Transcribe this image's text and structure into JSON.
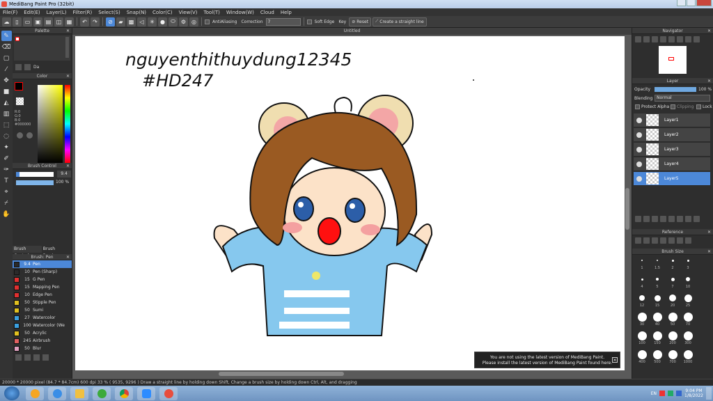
{
  "window": {
    "title": "MediBang Paint Pro (32bit)"
  },
  "menu": [
    "File(F)",
    "Edit(E)",
    "Layer(L)",
    "Filter(R)",
    "Select(S)",
    "Snap(N)",
    "Color(C)",
    "View(V)",
    "Tool(T)",
    "Window(W)",
    "Cloud",
    "Help"
  ],
  "toolbar": {
    "antialias_label": "AntiAliasing",
    "correction_label": "Correction",
    "correction_value": "7",
    "soft_edge_label": "Soft Edge",
    "key_label": "Key",
    "reset_label": "Reset",
    "straight_label": "Create a straight line"
  },
  "canvas": {
    "tab_title": "Untitled",
    "handwriting_line1": "nguyenthithuydung12345",
    "handwriting_line2": "#HD247"
  },
  "left_panels": {
    "palette": "Palette",
    "palette_item": "Da",
    "color": "Color",
    "rgb": [
      "R:0",
      "G:0",
      "B:0"
    ],
    "hex": "#000000",
    "brush_control": "Brush Control",
    "brush_size_value": "9.4",
    "brush_opacity_value": "100 %",
    "tab_brush_control": "Brush Control",
    "tab_brush_preview": "Brush Preview",
    "brush_list_title": "Brush: Pen"
  },
  "brushes": [
    {
      "size": "9.4",
      "name": "Pen",
      "color": "#2a2a2a"
    },
    {
      "size": "10",
      "name": "Pen (Sharp)",
      "color": "#2a2a2a"
    },
    {
      "size": "15",
      "name": "G Pen",
      "color": "#e03030"
    },
    {
      "size": "15",
      "name": "Mapping Pen",
      "color": "#e03030"
    },
    {
      "size": "10",
      "name": "Edge Pen",
      "color": "#e03030"
    },
    {
      "size": "50",
      "name": "Stipple Pen",
      "color": "#e0c020"
    },
    {
      "size": "50",
      "name": "Sumi",
      "color": "#e0c020"
    },
    {
      "size": "27",
      "name": "Watercolor",
      "color": "#3aa0e0"
    },
    {
      "size": "100",
      "name": "Watercolor (We",
      "color": "#3aa0e0"
    },
    {
      "size": "50",
      "name": "Acrylic",
      "color": "#e0c020"
    },
    {
      "size": "245",
      "name": "Airbrush",
      "color": "#e06060"
    },
    {
      "size": "50",
      "name": "Blur",
      "color": "#e0a0c0"
    }
  ],
  "right_panels": {
    "navigator": "Navigator",
    "layer": "Layer",
    "opacity_label": "Opacity",
    "opacity_value": "100 %",
    "blending_label": "Blending",
    "blending_value": "Normal",
    "protect_alpha": "Protect Alpha",
    "clipping": "Clipping",
    "lock": "Lock",
    "reference": "Reference",
    "brush_size": "Brush Size"
  },
  "layers": [
    "Layer1",
    "Layer2",
    "Layer3",
    "Layer4",
    "Layer5"
  ],
  "brush_sizes": [
    "1",
    "1.5",
    "2",
    "3",
    "4",
    "5",
    "7",
    "10",
    "12",
    "15",
    "20",
    "25",
    "30",
    "40",
    "50",
    "70",
    "100",
    "150",
    "200",
    "300",
    "400",
    "500",
    "700",
    "1000"
  ],
  "notice": {
    "line1": "You are not using the latest version of MediBang Paint.",
    "line2": "Please install the latest version of MediBang Paint found here."
  },
  "status": {
    "text": "20000 * 20000 pixel  (84.7 * 84.7cm)  600 dpi  33 %  ( 9535, 9296 )  Draw a straight line by holding down Shift, Change a brush size by holding down Ctrl, Alt, and dragging"
  },
  "taskbar": {
    "lang": "EN",
    "time": "9:04 PM",
    "date": "1/8/2022"
  }
}
